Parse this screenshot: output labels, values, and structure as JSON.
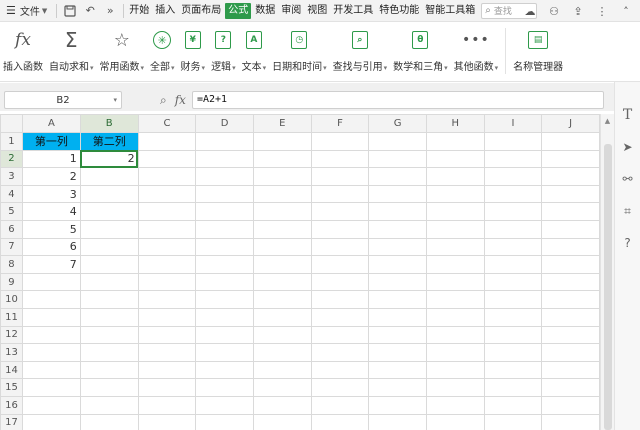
{
  "menubar": {
    "file_label": "文件",
    "tabs": [
      {
        "label": "开始",
        "active": false
      },
      {
        "label": "插入",
        "active": false
      },
      {
        "label": "页面布局",
        "active": false
      },
      {
        "label": "公式",
        "active": true
      },
      {
        "label": "数据",
        "active": false
      },
      {
        "label": "审阅",
        "active": false
      },
      {
        "label": "视图",
        "active": false
      },
      {
        "label": "开发工具",
        "active": false
      },
      {
        "label": "特色功能",
        "active": false
      },
      {
        "label": "智能工具箱",
        "active": false
      }
    ],
    "search_placeholder": "查找",
    "accent_color": "#2e9a4a"
  },
  "ribbon": {
    "buttons": [
      {
        "label": "插入函数",
        "icon": "fx-icon",
        "dropdown": false
      },
      {
        "label": "自动求和",
        "icon": "sigma-icon",
        "dropdown": true
      },
      {
        "label": "常用函数",
        "icon": "star-icon",
        "dropdown": true
      },
      {
        "label": "全部",
        "icon": "all-functions-icon",
        "dropdown": true
      },
      {
        "label": "财务",
        "icon": "finance-icon",
        "dropdown": true
      },
      {
        "label": "逻辑",
        "icon": "logic-icon",
        "dropdown": true
      },
      {
        "label": "文本",
        "icon": "text-icon",
        "dropdown": true
      },
      {
        "label": "日期和时间",
        "icon": "clock-icon",
        "dropdown": true
      },
      {
        "label": "查找与引用",
        "icon": "lookup-icon",
        "dropdown": true
      },
      {
        "label": "数学和三角",
        "icon": "math-icon",
        "dropdown": true
      },
      {
        "label": "其他函数",
        "icon": "more-icon",
        "dropdown": true
      },
      {
        "label": "名称管理器",
        "icon": "name-manager-icon",
        "dropdown": false
      }
    ]
  },
  "formula_bar": {
    "cell_ref": "B2",
    "formula": "=A2+1"
  },
  "sheet": {
    "columns": [
      "A",
      "B",
      "C",
      "D",
      "E",
      "F",
      "G",
      "H",
      "I",
      "J"
    ],
    "rows": [
      "1",
      "2",
      "3",
      "4",
      "5",
      "6",
      "7",
      "8",
      "9",
      "10",
      "11",
      "12",
      "13",
      "14",
      "15",
      "16",
      "17"
    ],
    "selected_column": "B",
    "selected_row": "2",
    "header_fill": "#00b0f0",
    "cells": {
      "A1": "第一列",
      "B1": "第二列",
      "A2": "1",
      "B2": "2",
      "A3": "2",
      "A4": "3",
      "A5": "4",
      "A6": "5",
      "A7": "6",
      "A8": "7"
    }
  },
  "right_panel": {
    "icons": [
      "text-style-icon",
      "cursor-icon",
      "adjust-icon",
      "crop-icon",
      "help-icon"
    ]
  }
}
